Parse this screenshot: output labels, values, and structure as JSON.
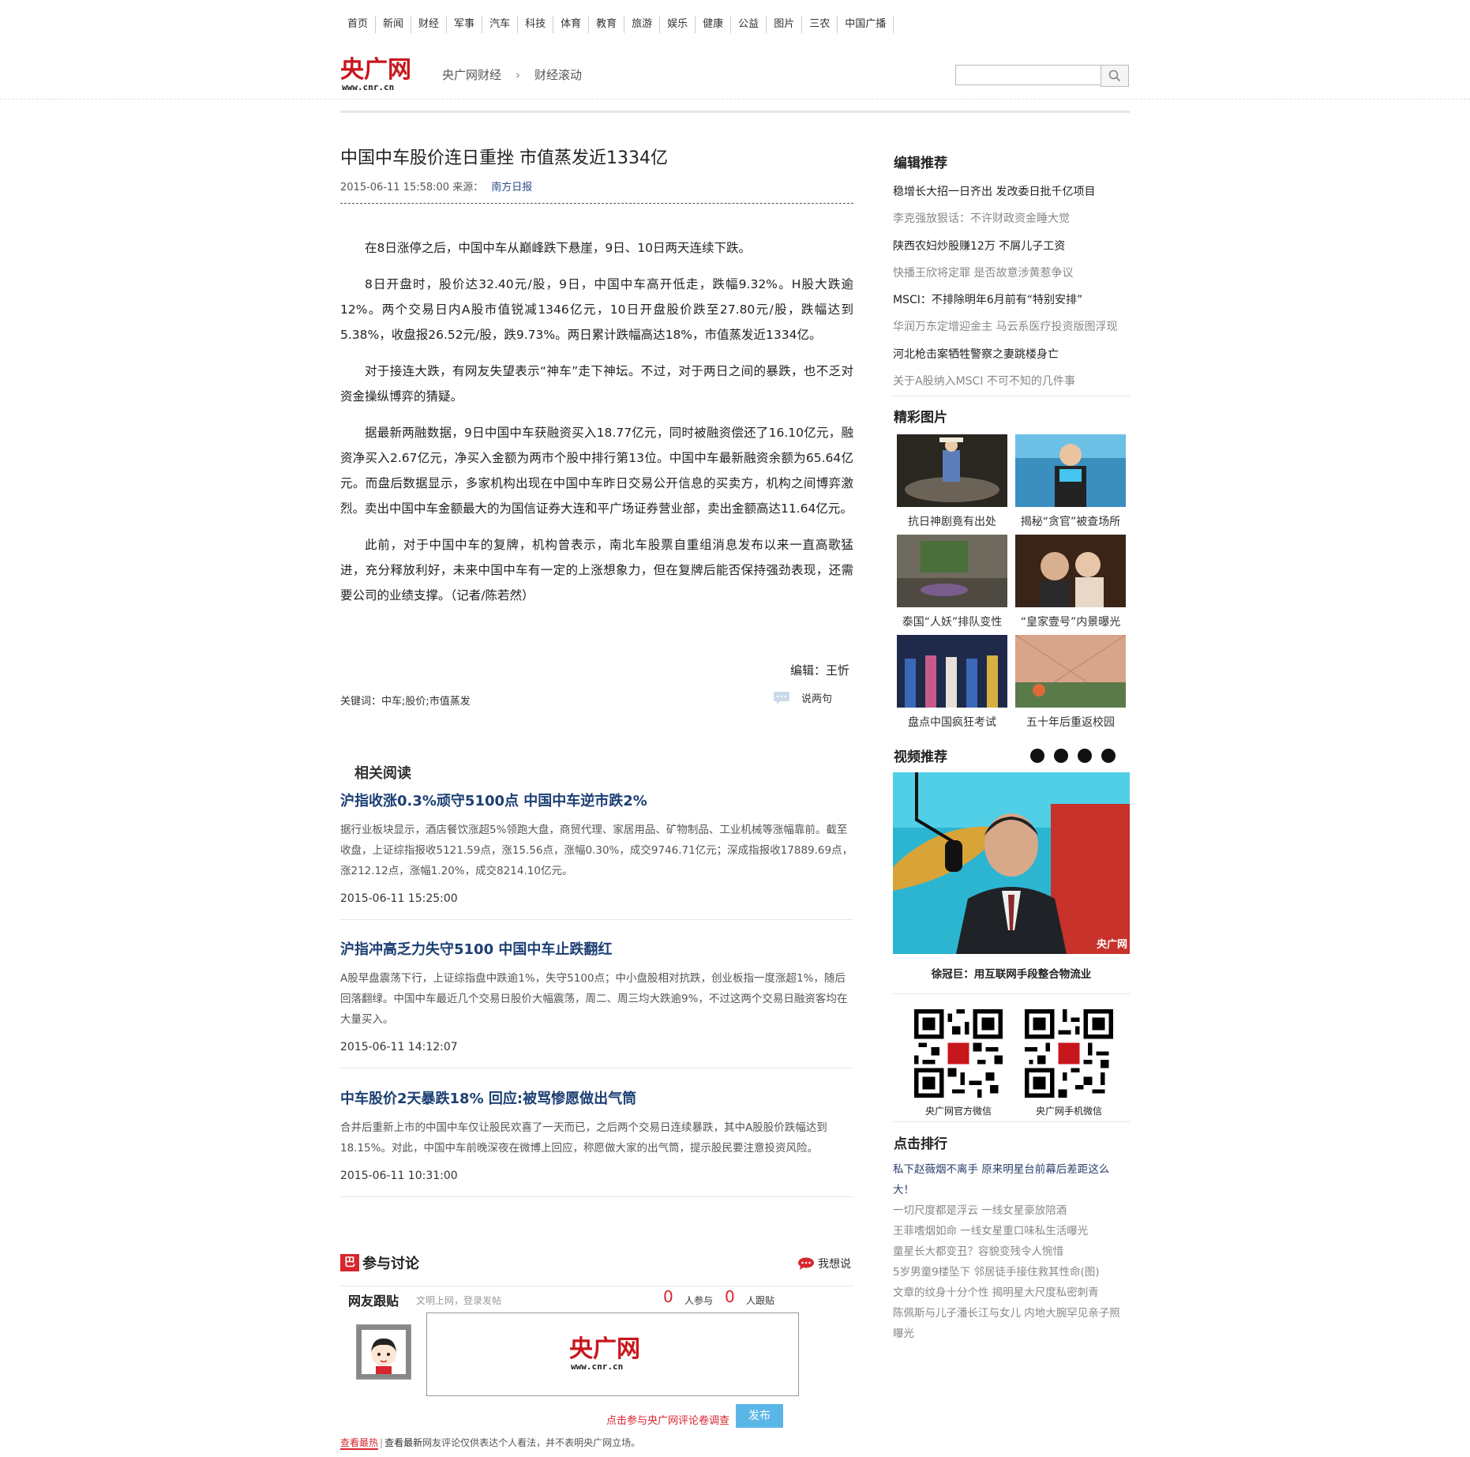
{
  "topnav": [
    "首页",
    "新闻",
    "财经",
    "军事",
    "汽车",
    "科技",
    "体育",
    "教育",
    "旅游",
    "娱乐",
    "健康",
    "公益",
    "图片",
    "三农",
    "中国广播"
  ],
  "header": {
    "logo_text": "央广网",
    "logo_sub": "www.cnr.cn",
    "crumb1": "央广网财经",
    "crumb_sep": "›",
    "crumb2": "财经滚动",
    "search_value": ""
  },
  "article": {
    "title": "中国中车股价连日重挫 市值蒸发近1334亿",
    "datetime": "2015-06-11 15:58:00",
    "source_label": "来源：",
    "source": "南方日报",
    "paragraphs": [
      "在8日涨停之后，中国中车从巅峰跌下悬崖，9日、10日两天连续下跌。",
      "8日开盘时，股价达32.40元/股，9日，中国中车高开低走，跌幅9.32%。H股大跌逾12%。两个交易日内A股市值锐减1346亿元，10日开盘股价跌至27.80元/股，跌幅达到5.38%，收盘报26.52元/股，跌9.73%。两日累计跌幅高达18%，市值蒸发近1334亿。",
      "对于接连大跌，有网友失望表示“神车”走下神坛。不过，对于两日之间的暴跌，也不乏对资金操纵博弈的猜疑。",
      "据最新两融数据，9日中国中车获融资买入18.77亿元，同时被融资偿还了16.10亿元，融资净买入2.67亿元，净买入金额为两市个股中排行第13位。中国中车最新融资余额为65.64亿元。而盘后数据显示，多家机构出现在中国中车昨日交易公开信息的买卖方，机构之间博弈激烈。卖出中国中车金额最大的为国信证券大连和平广场证券营业部，卖出金额高达11.64亿元。",
      "此前，对于中国中车的复牌，机构曾表示，南北车股票自重组消息发布以来一直高歌猛进，充分释放利好，未来中国中车有一定的上涨想象力，但在复牌后能否保持强劲表现，还需要公司的业绩支撑。（记者/陈若然）"
    ],
    "editor": "编辑：王忻",
    "keywords": "关键词：中车;股价;市值蒸发",
    "comment_link": "说两句"
  },
  "related": {
    "heading": "相关阅读",
    "items": [
      {
        "title": "沪指收涨0.3%顽守5100点 中国中车逆市跌2%",
        "desc": "据行业板块显示，酒店餐饮涨超5%领跑大盘，商贸代理、家居用品、矿物制品、工业机械等涨幅靠前。截至收盘，上证综指报收5121.59点，涨15.56点，涨幅0.30%，成交9746.71亿元；深成指报收17889.69点，涨212.12点，涨幅1.20%，成交8214.10亿元。",
        "time": "2015-06-11 15:25:00"
      },
      {
        "title": "沪指冲高乏力失守5100 中国中车止跌翻红",
        "desc": "A股早盘震荡下行，上证综指盘中跌逾1%，失守5100点；中小盘股相对抗跌，创业板指一度涨超1%，随后回落翻绿。中国中车最近几个交易日股价大幅震荡，周二、周三均大跌逾9%，不过这两个交易日融资客均在大量买入。",
        "time": "2015-06-11 14:12:07"
      },
      {
        "title": "中车股价2天暴跌18% 回应:被骂惨愿做出气筒",
        "desc": "合并后重新上市的中国中车仅让股民欢喜了一天而已，之后两个交易日连续暴跌，其中A股股价跌幅达到18.15%。对此，中国中车前晚深夜在微博上回应，称愿做大家的出气筒，提示股民要注意投资风险。",
        "time": "2015-06-11 10:31:00"
      }
    ]
  },
  "discussion": {
    "heading": "参与讨论",
    "icon_char": "巴",
    "want_say": "我想说",
    "reply_title": "网友跟贴",
    "reply_hint": "文明上网，登录发帖",
    "participants": "0",
    "participants_label": "人参与",
    "followers": "0",
    "followers_label": "人跟贴",
    "survey": "点击参与央广网评论卷调查",
    "post_button": "发布",
    "view_hot": "查看最热",
    "view_new": "查看最新",
    "disclaimer": "网友评论仅供表达个人看法，并不表明央广网立场。"
  },
  "sidebar": {
    "editor_pick_heading": "编辑推荐",
    "editor_picks": [
      {
        "text": "稳增长大招一日齐出 发改委日批千亿项目",
        "style": "dk"
      },
      {
        "text": "李克强放狠话：不许财政资金睡大觉",
        "style": "lt"
      },
      {
        "text": "陕西农妇炒股赚12万 不屑儿子工资",
        "style": "dk"
      },
      {
        "text": "快播王欣将定罪 是否故意涉黄惹争议",
        "style": "lt"
      },
      {
        "text": "MSCI：不排除明年6月前有“特别安排”",
        "style": "dk"
      },
      {
        "text": "华润万东定增迎金主 马云系医疗投资版图浮现",
        "style": "lt"
      },
      {
        "text": "河北枪击案牺牲警察之妻跳楼身亡",
        "style": "dk"
      },
      {
        "text": "关于A股纳入MSCI 不可不知的几件事",
        "style": "lt"
      }
    ],
    "pictures_heading": "精彩图片",
    "pictures": [
      "抗日神剧竟有出处",
      "揭秘“贪官”被查场所",
      "泰国“人妖”排队变性",
      "“皇家壹号”内景曝光",
      "盘点中国疯狂考试",
      "五十年后重返校园"
    ],
    "video_heading": "视频推荐",
    "video_caption": "徐冠巨：用互联网手段整合物流业",
    "qr_official": "央广网官方微信",
    "qr_mobile": "央广网手机微信",
    "ranking_heading": "点击排行",
    "ranking": [
      "私下赵薇烟不离手 原来明星台前幕后差距这么大！",
      "一切尺度都是浮云 一线女星豪放陪酒",
      "王菲嗜烟如命 一线女星重口味私生活曝光",
      "童星长大都变丑？容貌变残令人惋惜",
      "5岁男童9楼坠下 邻居徒手接住救其性命(图)",
      "文章的纹身十分个性 揭明星大尺度私密刺青",
      "陈佩斯与儿子潘长江与女儿 内地大腕罕见亲子照曝光"
    ]
  }
}
